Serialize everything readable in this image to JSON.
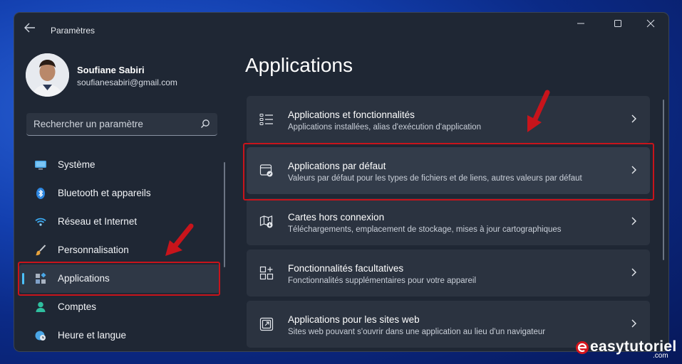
{
  "window": {
    "title": "Paramètres",
    "back_icon": "back-arrow-icon"
  },
  "profile": {
    "name": "Soufiane Sabiri",
    "email": "soufianesabiri@gmail.com"
  },
  "search": {
    "placeholder": "Rechercher un paramètre"
  },
  "sidebar": {
    "items": [
      {
        "label": "Système",
        "icon": "monitor-icon"
      },
      {
        "label": "Bluetooth et appareils",
        "icon": "bluetooth-icon"
      },
      {
        "label": "Réseau et Internet",
        "icon": "wifi-icon"
      },
      {
        "label": "Personnalisation",
        "icon": "brush-icon"
      },
      {
        "label": "Applications",
        "icon": "apps-icon",
        "active": true
      },
      {
        "label": "Comptes",
        "icon": "person-icon"
      },
      {
        "label": "Heure et langue",
        "icon": "clock-globe-icon"
      }
    ]
  },
  "main": {
    "title": "Applications",
    "cards": [
      {
        "title": "Applications et fonctionnalités",
        "desc": "Applications installées, alias d'exécution d'application",
        "icon": "list-icon"
      },
      {
        "title": "Applications par défaut",
        "desc": "Valeurs par défaut pour les types de fichiers et de liens, autres valeurs par défaut",
        "icon": "default-apps-icon"
      },
      {
        "title": "Cartes hors connexion",
        "desc": "Téléchargements, emplacement de stockage, mises à jour cartographiques",
        "icon": "map-icon"
      },
      {
        "title": "Fonctionnalités facultatives",
        "desc": "Fonctionnalités supplémentaires pour votre appareil",
        "icon": "grid-add-icon"
      },
      {
        "title": "Applications pour les sites web",
        "desc": "Sites web pouvant s'ouvrir dans une application au lieu d'un navigateur",
        "icon": "open-link-icon"
      }
    ]
  },
  "colors": {
    "accent": "#4cc2ff",
    "highlight_red": "#c8141b",
    "window_bg": "#1f2734",
    "card_bg": "#2b3340"
  },
  "watermark": {
    "text": "easytutoriel",
    "suffix": ".com"
  }
}
